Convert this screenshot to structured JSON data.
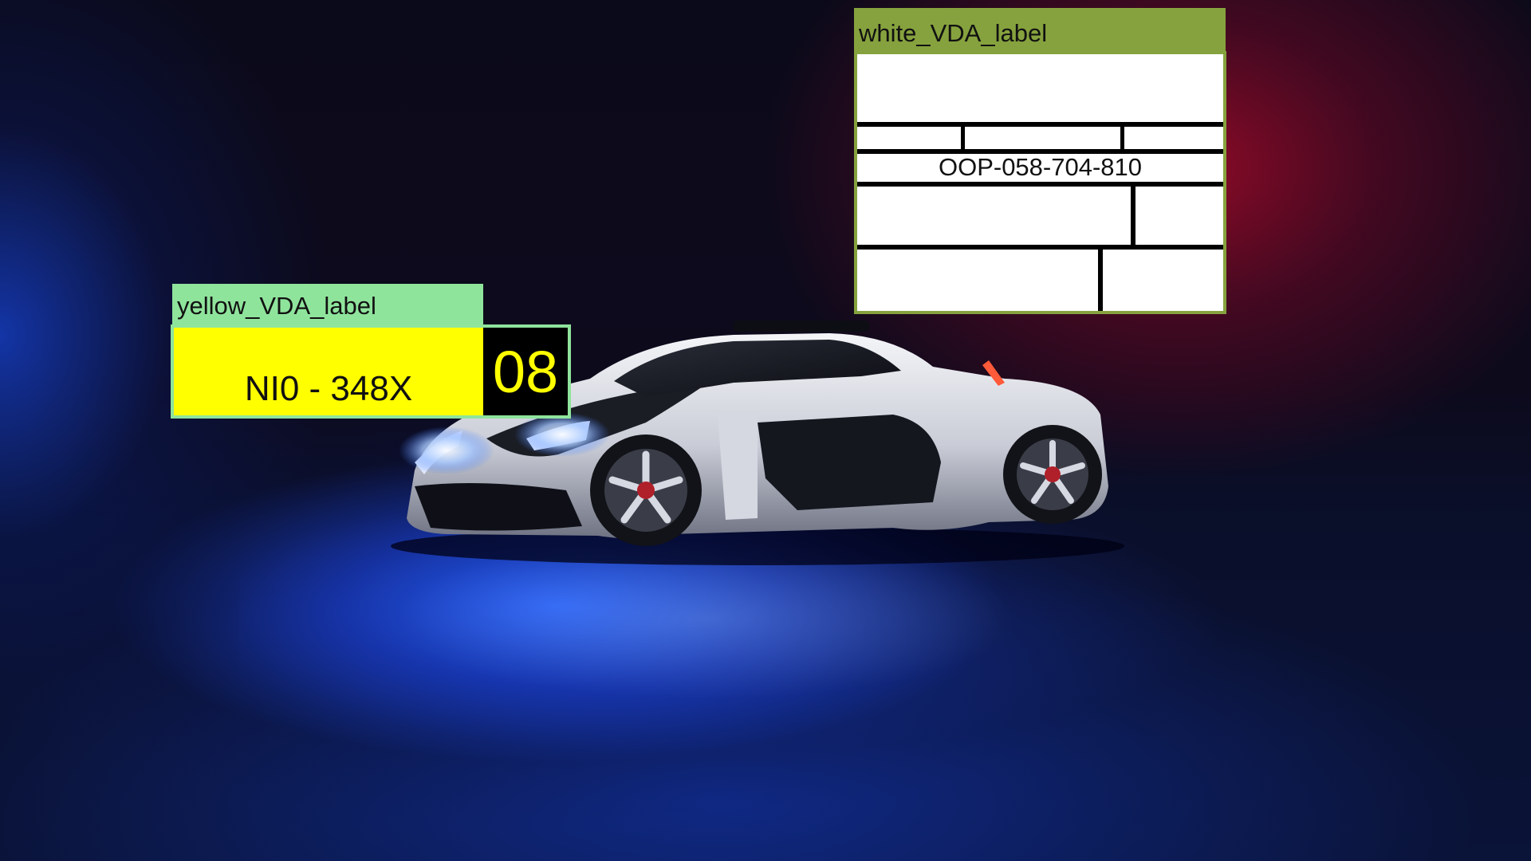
{
  "scene": {
    "description_colors": {
      "left_glow": "#1e3cd2",
      "right_glow": "#960a28",
      "floor_light": "#2864ff",
      "car_body": "#e6e8ef"
    }
  },
  "annotations": [
    {
      "class_label": "yellow_VDA_label",
      "header_color": "#8fe49c",
      "plate_text": "NI0 - 348X",
      "plate_number": "08",
      "plate_background": "#ffff00"
    },
    {
      "class_label": "white_VDA_label",
      "header_color": "#86a23e",
      "code_text": "OOP-058-704-810",
      "label_background": "#ffffff"
    }
  ]
}
